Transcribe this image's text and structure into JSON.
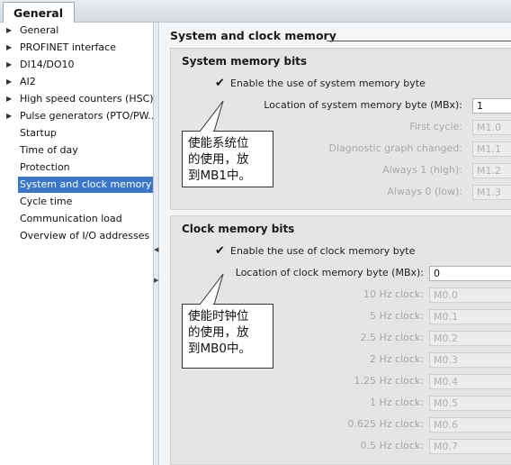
{
  "tab": {
    "label": "General"
  },
  "tree": {
    "items": [
      {
        "label": "General",
        "arrow": "▶"
      },
      {
        "label": "PROFINET interface",
        "arrow": "▶"
      },
      {
        "label": "DI14/DO10",
        "arrow": "▶"
      },
      {
        "label": "AI2",
        "arrow": "▶"
      },
      {
        "label": "High speed counters (HSC)",
        "arrow": "▶"
      },
      {
        "label": "Pulse generators (PTO/PW...",
        "arrow": "▶"
      },
      {
        "label": "Startup",
        "arrow": ""
      },
      {
        "label": "Time of day",
        "arrow": ""
      },
      {
        "label": "Protection",
        "arrow": ""
      },
      {
        "label": "System and clock memory",
        "arrow": "",
        "selected": true
      },
      {
        "label": "Cycle time",
        "arrow": ""
      },
      {
        "label": "Communication load",
        "arrow": ""
      },
      {
        "label": "Overview of I/O addresses",
        "arrow": ""
      }
    ]
  },
  "content": {
    "title": "System and clock memory",
    "system": {
      "title": "System memory bits",
      "checkbox_label": "Enable the use of system memory byte",
      "checked": true,
      "location_label": "Location of system memory byte (MBx):",
      "location_value": "1",
      "rows": [
        {
          "label": "First cycle:",
          "value": "M1.0"
        },
        {
          "label": "Diagnostic graph changed:",
          "value": "M1.1"
        },
        {
          "label": "Always 1 (high):",
          "value": "M1.2"
        },
        {
          "label": "Always 0 (low):",
          "value": "M1.3"
        }
      ],
      "callout": "使能系统位\n的使用，放\n到MB1中。"
    },
    "clock": {
      "title": "Clock memory bits",
      "checkbox_label": "Enable the use of clock memory byte",
      "checked": true,
      "location_label": "Location of clock memory byte (MBx):",
      "location_value": "0",
      "rows": [
        {
          "label": "10 Hz clock:",
          "value": "M0.0"
        },
        {
          "label": "5 Hz clock:",
          "value": "M0.1"
        },
        {
          "label": "2.5 Hz clock:",
          "value": "M0.2"
        },
        {
          "label": "2 Hz clock:",
          "value": "M0.3"
        },
        {
          "label": "1.25 Hz clock:",
          "value": "M0.4"
        },
        {
          "label": "1 Hz clock:",
          "value": "M0.5"
        },
        {
          "label": "0.625 Hz clock:",
          "value": "M0.6"
        },
        {
          "label": "0.5 Hz clock:",
          "value": "M0.7"
        }
      ],
      "callout": "使能时钟位\n的使用，放\n到MB0中。"
    }
  },
  "colors": {
    "selection": "#3a77c8",
    "panel": "#e5e5e5"
  }
}
